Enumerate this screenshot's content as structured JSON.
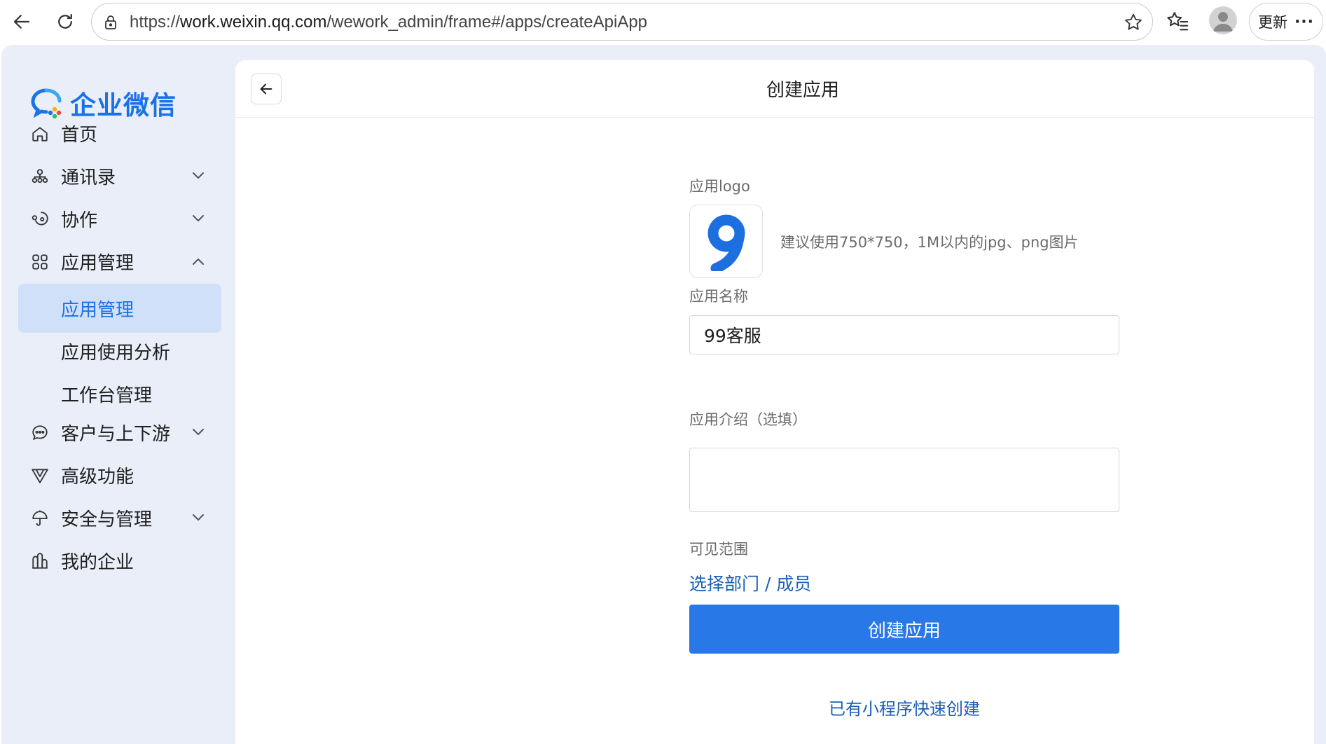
{
  "browser": {
    "url_prefix": "https://",
    "url_host": "work.weixin.qq.com",
    "url_path": "/wework_admin/frame#/apps/createApiApp",
    "update_label": "更新",
    "more_label": "···"
  },
  "sidebar": {
    "logo_text": "企业微信",
    "items": [
      {
        "label": "首页",
        "icon": "home-icon",
        "has_chevron": false
      },
      {
        "label": "通讯录",
        "icon": "contacts-icon",
        "has_chevron": true
      },
      {
        "label": "协作",
        "icon": "collaboration-icon",
        "has_chevron": true
      },
      {
        "label": "应用管理",
        "icon": "apps-grid-icon",
        "has_chevron": true,
        "expanded": true
      },
      {
        "label": "应用管理",
        "sub": true,
        "active": true
      },
      {
        "label": "应用使用分析",
        "sub": true
      },
      {
        "label": "工作台管理",
        "sub": true
      },
      {
        "label": "客户与上下游",
        "icon": "chat-bubble-icon",
        "has_chevron": true
      },
      {
        "label": "高级功能",
        "icon": "advanced-icon",
        "has_chevron": false
      },
      {
        "label": "安全与管理",
        "icon": "umbrella-icon",
        "has_chevron": true
      },
      {
        "label": "我的企业",
        "icon": "building-icon",
        "has_chevron": false
      }
    ]
  },
  "header": {
    "title": "创建应用"
  },
  "form": {
    "logo_label": "应用logo",
    "logo_hint": "建议使用750*750，1M以内的jpg、png图片",
    "name_label": "应用名称",
    "name_value": "99客服",
    "desc_label": "应用介绍（选填）",
    "desc_value": "",
    "scope_label": "可见范围",
    "scope_link": "选择部门 / 成员",
    "create_button": "创建应用",
    "mini_program_link": "已有小程序快速创建"
  },
  "colors": {
    "accent": "#2878e8",
    "link": "#1a5fb4",
    "sidebar_bg": "#e9eef8",
    "active_item_bg": "#cfe0f8"
  }
}
